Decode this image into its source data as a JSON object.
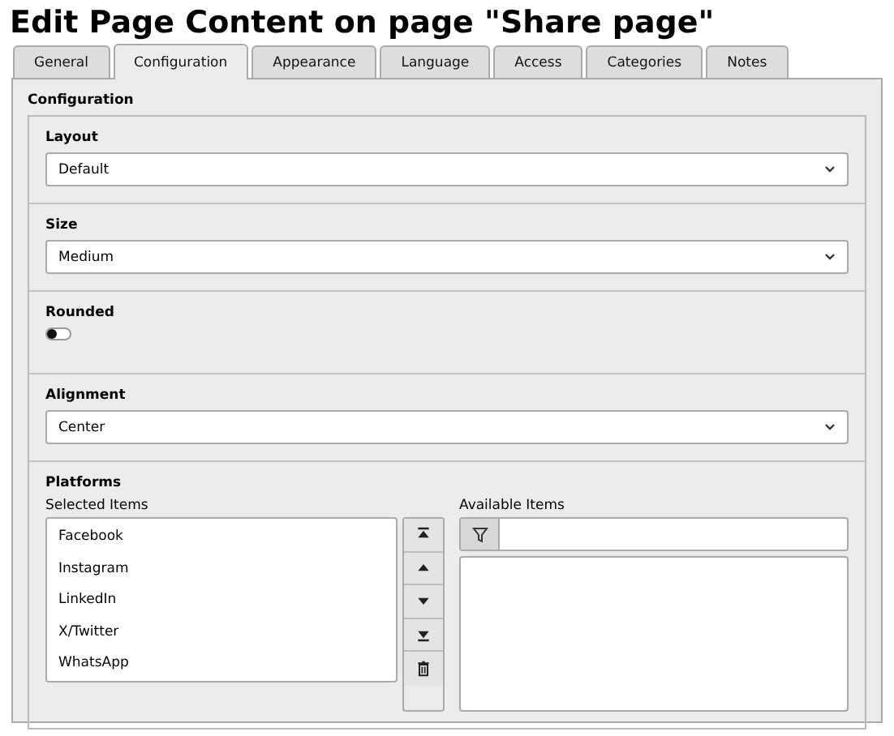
{
  "title": "Edit Page Content on page \"Share page\"",
  "tabs": [
    {
      "label": "General",
      "selected": false
    },
    {
      "label": "Configuration",
      "selected": true
    },
    {
      "label": "Appearance",
      "selected": false
    },
    {
      "label": "Language",
      "selected": false
    },
    {
      "label": "Access",
      "selected": false
    },
    {
      "label": "Categories",
      "selected": false
    },
    {
      "label": "Notes",
      "selected": false
    }
  ],
  "fieldset": {
    "legend": "Configuration",
    "fields": [
      {
        "kind": "select",
        "label": "Layout",
        "value": "Default"
      },
      {
        "kind": "select",
        "label": "Size",
        "value": "Medium"
      },
      {
        "kind": "toggle",
        "label": "Rounded",
        "on": false
      },
      {
        "kind": "select",
        "label": "Alignment",
        "value": "Center"
      },
      {
        "kind": "multiselect",
        "label": "Platforms",
        "selected_label": "Selected Items",
        "available_label": "Available Items",
        "selected_items": [
          "Facebook",
          "Instagram",
          "LinkedIn",
          "X/Twitter",
          "WhatsApp"
        ]
      }
    ]
  }
}
